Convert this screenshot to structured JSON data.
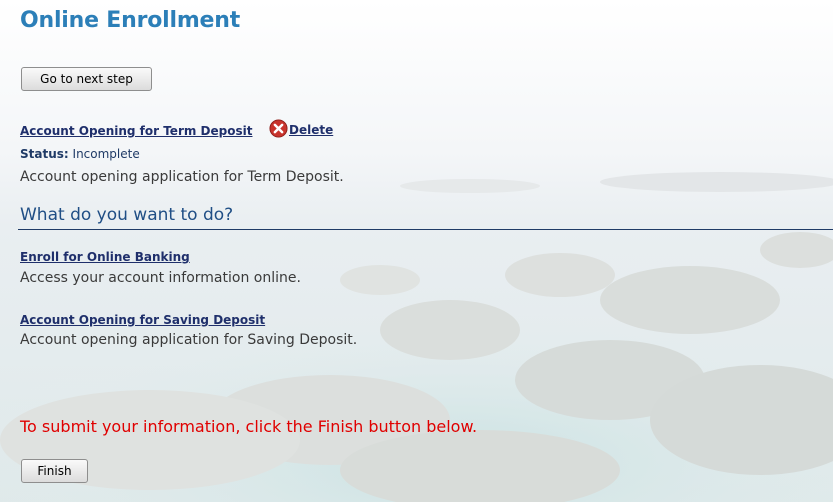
{
  "page": {
    "title": "Online Enrollment"
  },
  "buttons": {
    "next_step": "Go to next step",
    "finish": "Finish"
  },
  "pending": {
    "link": "Account Opening for Term Deposit",
    "delete_label": "Delete",
    "delete_icon": "delete-circle-icon",
    "status_label": "Status:",
    "status_value": "Incomplete",
    "description": "Account opening application for Term Deposit."
  },
  "options": {
    "heading": "What do you want to do?",
    "items": [
      {
        "link": "Enroll for Online Banking",
        "description": "Access your account information online."
      },
      {
        "link": "Account Opening for Saving Deposit",
        "description": "Account opening application for Saving Deposit."
      }
    ]
  },
  "submit": {
    "note": "To submit your information, click the Finish button below."
  },
  "colors": {
    "title": "#2c7fb8",
    "link": "#1f2f6b",
    "heading": "#1f4e85",
    "warning": "#e00000",
    "delete_icon": "#c8342d"
  }
}
